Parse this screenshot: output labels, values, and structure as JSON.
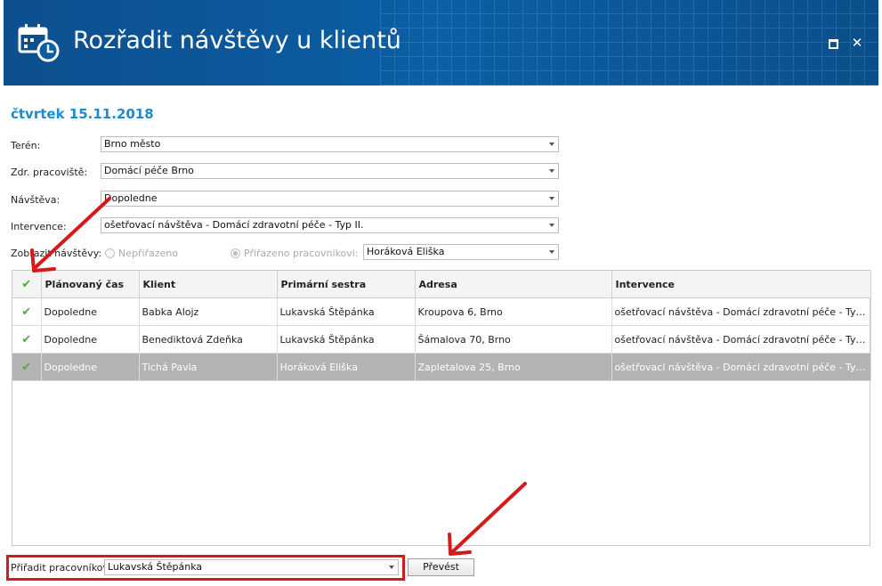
{
  "window": {
    "title": "Rozřadit návštěvy u klientů",
    "controls": [
      "maximize-icon",
      "close-icon"
    ],
    "close_glyph": "✕"
  },
  "date_heading": "čtvrtek 15.11.2018",
  "form": {
    "teren": {
      "label": "Terén:",
      "value": "Brno město"
    },
    "pracoviste": {
      "label": "Zdr. pracoviště:",
      "value": "Domácí péče Brno"
    },
    "navsteva": {
      "label": "Návštěva:",
      "value": "Dopoledne"
    },
    "intervence": {
      "label": "Intervence:",
      "value": "ošetřovací návštěva - Domácí zdravotní péče - Typ II."
    },
    "zobrazit": {
      "label": "Zobrazit návštěvy:",
      "option_unassigned": "Nepřiřazeno",
      "option_assigned": "Přiřazeno pracovníkovi:",
      "selected_option": "Přiřazeno pracovníkovi:",
      "worker_value": "Horáková Eliška"
    }
  },
  "grid": {
    "check_glyph": "✔",
    "columns": [
      "Plánovaný čas",
      "Klient",
      "Primární sestra",
      "Adresa",
      "Intervence"
    ],
    "rows": [
      {
        "checked": true,
        "time": "Dopoledne",
        "client": "Babka Alojz",
        "nurse": "Lukavská Štěpánka",
        "address": "Kroupova 6, Brno",
        "intervention": "ošetřovací návštěva - Domácí zdravotní péče - Typ II.",
        "selected": false
      },
      {
        "checked": true,
        "time": "Dopoledne",
        "client": "Benediktová Zdeňka",
        "nurse": "Lukavská Štěpánka",
        "address": "Šámalova 70, Brno",
        "intervention": "ošetřovací návštěva - Domácí zdravotní péče - Typ II.…",
        "selected": false
      },
      {
        "checked": true,
        "time": "Dopoledne",
        "client": "Tichá Pavla",
        "nurse": "Horáková Eliška",
        "address": "Zapletalova 25, Brno",
        "intervention": "ošetřovací návštěva - Domácí zdravotní péče - Typ II.…",
        "selected": true
      }
    ]
  },
  "assign": {
    "label": "Přiřadit pracovníkovi:",
    "value": "Lukavská Štěpánka",
    "button_label": "Převést"
  },
  "colors": {
    "title_bar": "#0b5fa5",
    "date_heading": "#1e8ad0",
    "annotation": "#d41a1a",
    "check": "#47b233",
    "selected_row": "#b3b3b3"
  }
}
